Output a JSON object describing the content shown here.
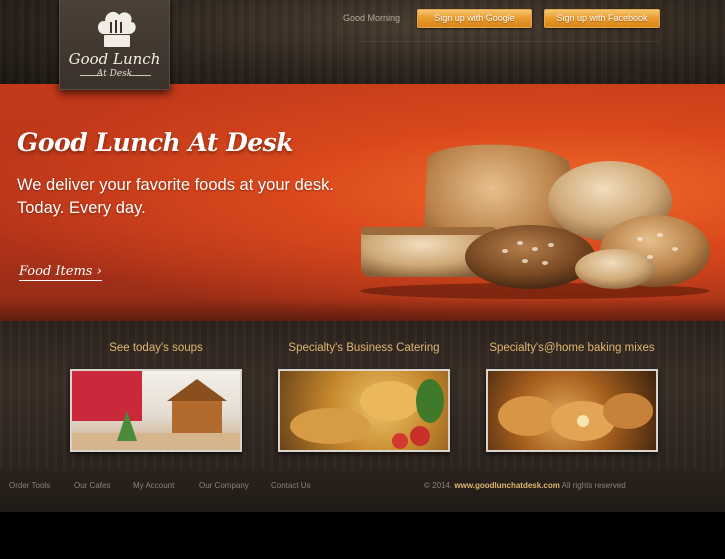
{
  "header": {
    "logo": {
      "line1": "Good Lunch",
      "line2": "At Desk"
    },
    "greeting": "Good Morning",
    "google_button": "Sign up with Google",
    "facebook_button": "Sign up with Facebook"
  },
  "hero": {
    "title": "Good Lunch At Desk",
    "tagline_line1": "We deliver your favorite foods at your desk.",
    "tagline_line2": "Today. Every day.",
    "link_label": "Food Items ›"
  },
  "features": [
    {
      "title": "See today's soups",
      "image": "gingerbread-house-photo"
    },
    {
      "title": "Specialty's Business Catering",
      "image": "catering-platter-photo"
    },
    {
      "title": "Specialty's@home baking mixes",
      "image": "pastries-photo"
    }
  ],
  "footer": {
    "links": [
      "Order Tools",
      "Our Cafes",
      "My Account",
      "Our Company",
      "Contact Us"
    ],
    "copyright_prefix": "© 2014.",
    "copyright_site": "www.goodlunchatdesk.com",
    "copyright_suffix": "All rights reserved"
  },
  "colors": {
    "accent_orange": "#e89a2c",
    "hero_red": "#c3391a",
    "feature_title": "#e0b772"
  }
}
